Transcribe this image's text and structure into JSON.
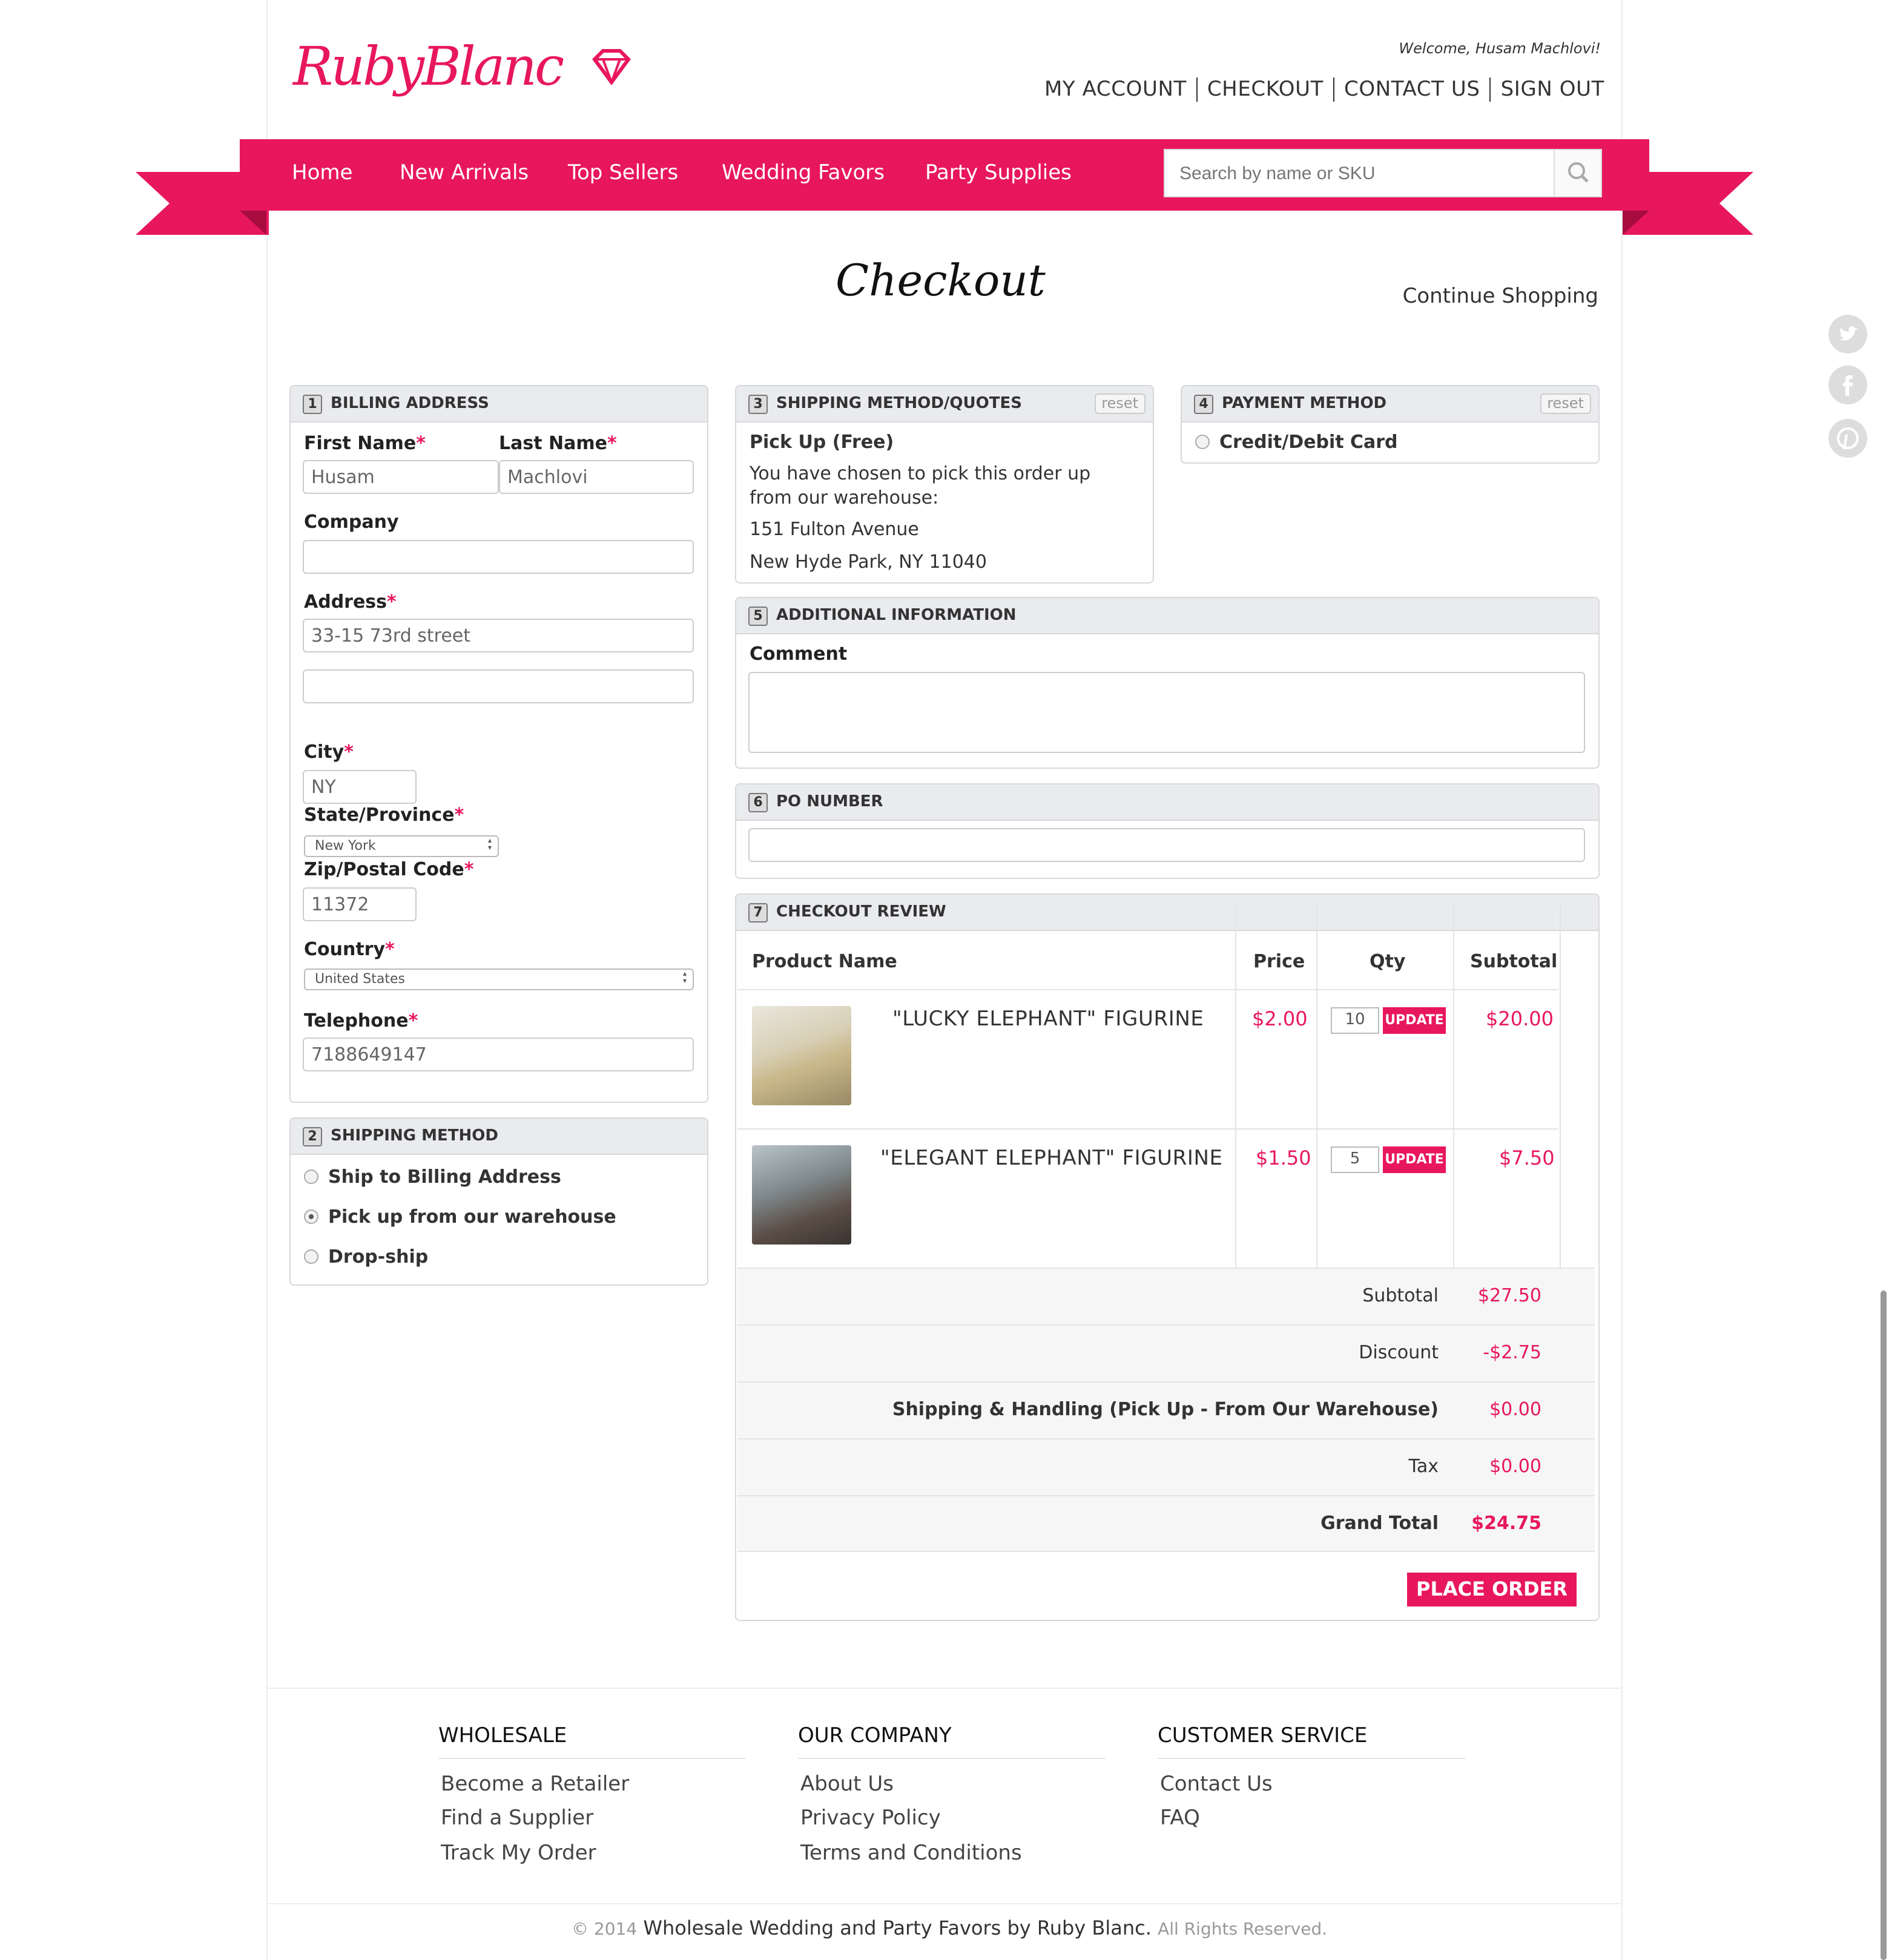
{
  "brand": {
    "logo_text": "RubyBlanc",
    "accent": "#e8175d"
  },
  "header": {
    "welcome": "Welcome, Husam Machlovi!",
    "links": [
      "MY ACCOUNT",
      "CHECKOUT",
      "CONTACT US",
      "SIGN OUT"
    ]
  },
  "nav": {
    "items": [
      "Home",
      "New Arrivals",
      "Top Sellers",
      "Wedding Favors",
      "Party Supplies"
    ],
    "search_placeholder": "Search by name or SKU"
  },
  "page": {
    "title": "Checkout",
    "continue": "Continue Shopping"
  },
  "billing": {
    "num": "1",
    "title": "BILLING ADDRESS",
    "first_name_label": "First Name",
    "last_name_label": "Last Name",
    "first_name": "Husam",
    "last_name": "Machlovi",
    "company_label": "Company",
    "company": "",
    "address_label": "Address",
    "address1": "33-15 73rd street",
    "address2": "",
    "city_label": "City",
    "city": "NY",
    "state_label": "State/Province",
    "state": "New York",
    "zip_label": "Zip/Postal Code",
    "zip": "11372",
    "country_label": "Country",
    "country": "United States",
    "phone_label": "Telephone",
    "phone": "7188649147",
    "required_mark": "*"
  },
  "shipping_method": {
    "num": "2",
    "title": "SHIPPING METHOD",
    "options": [
      "Ship to Billing Address",
      "Pick up from our warehouse",
      "Drop-ship"
    ],
    "selected": "Pick up from our warehouse"
  },
  "quotes": {
    "num": "3",
    "title": "SHIPPING METHOD/QUOTES",
    "reset": "reset",
    "method": "Pick Up (Free)",
    "desc": "You have chosen to pick this order up from our warehouse:",
    "street": "151 Fulton Avenue",
    "city": "New Hyde Park, NY 11040"
  },
  "payment": {
    "num": "4",
    "title": "PAYMENT METHOD",
    "reset": "reset",
    "option": "Credit/Debit Card"
  },
  "additional": {
    "num": "5",
    "title": "ADDITIONAL INFORMATION",
    "comment_label": "Comment",
    "comment": ""
  },
  "po": {
    "num": "6",
    "title": "PO NUMBER",
    "value": ""
  },
  "review": {
    "num": "7",
    "title": "CHECKOUT REVIEW",
    "headers": [
      "Product Name",
      "Price",
      "Qty",
      "Subtotal"
    ],
    "items": [
      {
        "name": "\"LUCKY ELEPHANT\" FIGURINE",
        "price": "$2.00",
        "qty": "10",
        "update": "UPDATE",
        "subtotal": "$20.00"
      },
      {
        "name": "\"ELEGANT ELEPHANT\" FIGURINE",
        "price": "$1.50",
        "qty": "5",
        "update": "UPDATE",
        "subtotal": "$7.50"
      }
    ],
    "totals": [
      {
        "label": "Subtotal",
        "value": "$27.50"
      },
      {
        "label": "Discount",
        "value": "-$2.75"
      },
      {
        "label": "Shipping & Handling (Pick Up - From Our Warehouse)",
        "value": "$0.00"
      },
      {
        "label": "Tax",
        "value": "$0.00"
      },
      {
        "label": "Grand Total",
        "value": "$24.75"
      }
    ],
    "place_order": "PLACE ORDER"
  },
  "footer": {
    "wholesale": {
      "title": "WHOLESALE",
      "links": [
        "Become a Retailer",
        "Find a Supplier",
        "Track My Order"
      ]
    },
    "company": {
      "title": "OUR COMPANY",
      "links": [
        "About Us",
        "Privacy Policy",
        "Terms and Conditions"
      ]
    },
    "service": {
      "title": "CUSTOMER SERVICE",
      "links": [
        "Contact Us",
        "FAQ"
      ]
    },
    "copyright_prefix": "© 2014",
    "copyright_main": "Wholesale Wedding and Party Favors by Ruby Blanc.",
    "copyright_suffix": "All Rights Reserved."
  },
  "social": [
    "twitter-icon",
    "facebook-icon",
    "pinterest-icon"
  ]
}
